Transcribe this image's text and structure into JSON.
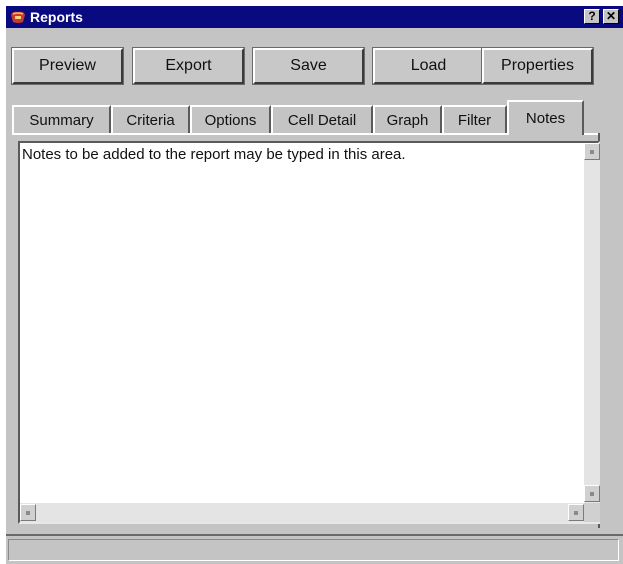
{
  "window": {
    "title": "Reports",
    "help_label": "?",
    "close_label": "✕",
    "title_bar_color": "#0a0a80",
    "app_icon": "reports-app-icon"
  },
  "toolbar": {
    "preview_label": "Preview",
    "export_label": "Export",
    "save_label": "Save",
    "load_label": "Load",
    "properties_label": "Properties"
  },
  "tabs": [
    {
      "label": "Summary",
      "active": false
    },
    {
      "label": "Criteria",
      "active": false
    },
    {
      "label": "Options",
      "active": false
    },
    {
      "label": "Cell Detail",
      "active": false
    },
    {
      "label": "Graph",
      "active": false
    },
    {
      "label": "Filter",
      "active": false
    },
    {
      "label": "Notes",
      "active": true
    }
  ],
  "notes": {
    "text": "Notes to be added to the report may be typed in this area."
  },
  "status": {
    "text": ""
  }
}
